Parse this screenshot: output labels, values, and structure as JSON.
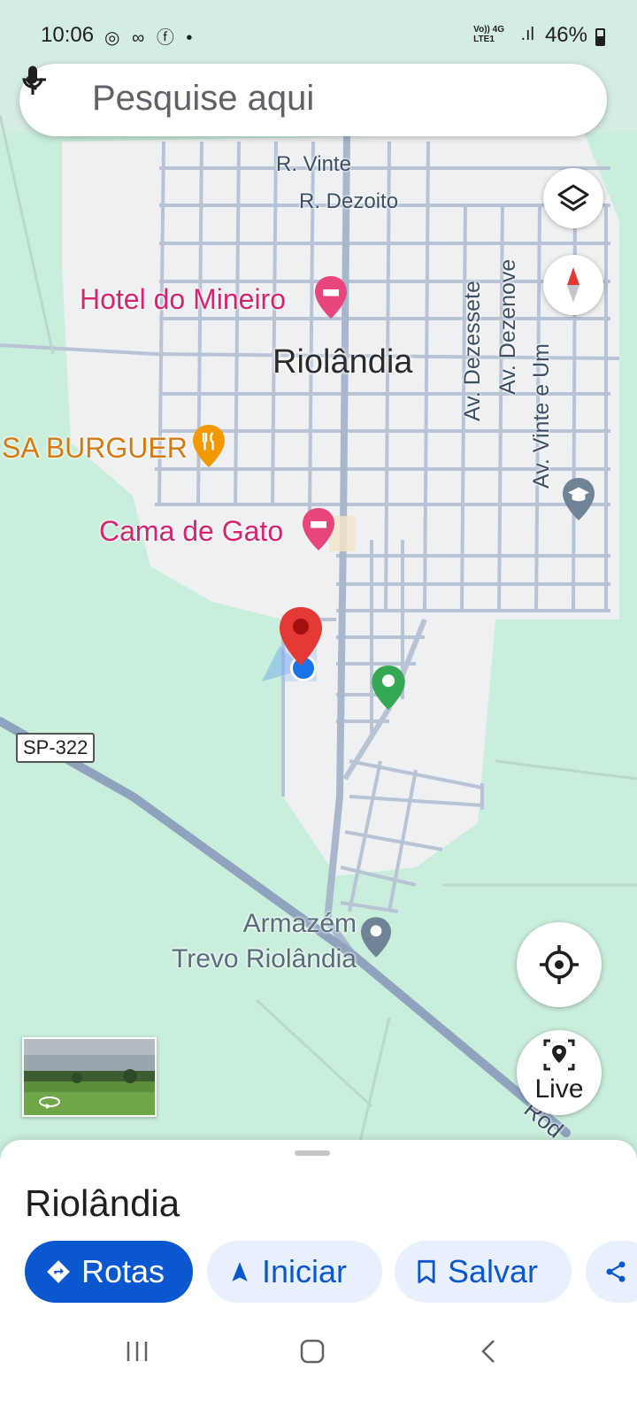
{
  "status_bar": {
    "time": "10:06",
    "network": "Vo)) 4G\nLTE1",
    "battery": "46%"
  },
  "search": {
    "placeholder": "Pesquise aqui"
  },
  "map": {
    "labels": {
      "street_vinte": "R. Vinte",
      "street_dezoito": "R. Dezoito",
      "hotel_mineiro": "Hotel do Mineiro",
      "city": "Riolândia",
      "burger": "SA BURGUER",
      "cama_gato": "Cama de Gato",
      "av_dezessete": "Av. Dezessete",
      "av_dezenove": "Av. Dezenove",
      "av_vinte_um": "Av. Vinte e Um",
      "armazem_line1": "Armazém",
      "armazem_line2": "Trevo Riolândia",
      "road_shield": "SP-322",
      "rodovia_fragment": "Rod"
    },
    "colors": {
      "land": "#c9eedb",
      "urban": "#eef0f2",
      "road": "#b6c2d4",
      "highway": "#8fa3bf",
      "pin_red": "#e53935",
      "pin_green": "#34a853",
      "location_blue": "#1a73e8"
    }
  },
  "controls": {
    "layers_icon": "layers-icon",
    "compass_icon": "compass-icon",
    "my_location_icon": "crosshair-icon",
    "live_label": "Live"
  },
  "sheet": {
    "title": "Riolândia",
    "actions": {
      "directions": "Rotas",
      "start": "Iniciar",
      "save": "Salvar"
    }
  }
}
